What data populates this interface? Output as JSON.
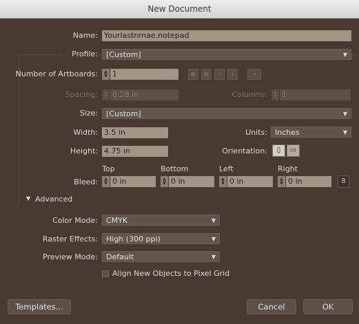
{
  "window": {
    "title": "New Document"
  },
  "name": {
    "label": "Name:",
    "value": "Yourlastnmae.notepad"
  },
  "profile": {
    "label": "Profile:",
    "value": "[Custom]"
  },
  "artboards": {
    "label": "Number of Artboards:",
    "value": "1"
  },
  "spacing": {
    "label": "Spacing:",
    "value": "0.28 in"
  },
  "columns": {
    "label": "Columns:",
    "value": "1"
  },
  "size": {
    "label": "Size:",
    "value": "[Custom]"
  },
  "width": {
    "label": "Width:",
    "value": "3.5 in"
  },
  "units": {
    "label": "Units:",
    "value": "Inches"
  },
  "height": {
    "label": "Height:",
    "value": "4.75 in"
  },
  "orientation": {
    "label": "Orientation:",
    "selected": "portrait"
  },
  "bleed": {
    "label": "Bleed:",
    "top": {
      "label": "Top",
      "value": "0 in"
    },
    "bottom": {
      "label": "Bottom",
      "value": "0 in"
    },
    "left": {
      "label": "Left",
      "value": "0 in"
    },
    "right": {
      "label": "Right",
      "value": "0 in"
    }
  },
  "advanced": {
    "label": "Advanced",
    "expanded": true
  },
  "color_mode": {
    "label": "Color Mode:",
    "value": "CMYK"
  },
  "raster_effects": {
    "label": "Raster Effects:",
    "value": "High (300 ppi)"
  },
  "preview_mode": {
    "label": "Preview Mode:",
    "value": "Default"
  },
  "pixel_grid": {
    "label": "Align New Objects to Pixel Grid",
    "checked": false
  },
  "buttons": {
    "templates": "Templates...",
    "cancel": "Cancel",
    "ok": "OK"
  },
  "icons": {
    "arrange_grid_row": "grid-by-row-icon",
    "arrange_grid_col": "grid-by-column-icon",
    "arrange_row": "arrange-row-icon",
    "arrange_col": "arrange-column-icon",
    "rtl": "right-to-left-icon",
    "portrait": "portrait-icon",
    "landscape": "landscape-icon",
    "link": "link-icon"
  },
  "colors": {
    "accent_field": "#a39585",
    "dialog_bg": "#483a30"
  }
}
